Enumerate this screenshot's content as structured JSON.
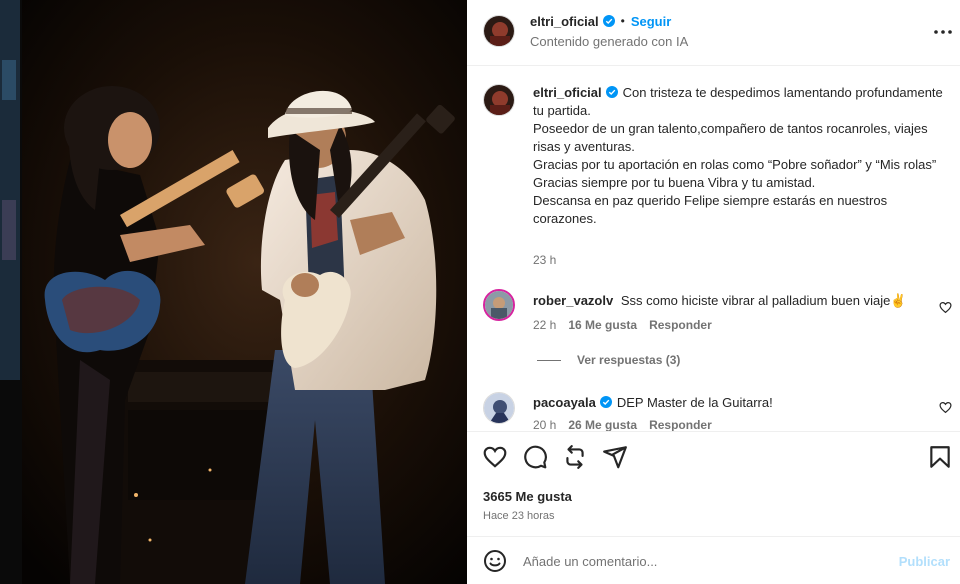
{
  "post": {
    "author": "eltri_oficial",
    "follow_label": "Seguir",
    "separator": "•",
    "subtitle": "Contenido generado con IA",
    "more_icon": "more-horizontal-icon"
  },
  "caption": {
    "username": "eltri_oficial",
    "lines": [
      "Con tristeza te despedimos lamentando profundamente tu partida.",
      "Poseedor de un gran talento,compañero de tantos rocanroles, viajes risas y aventuras.",
      "Gracias por tu aportación en rolas como “Pobre soñador” y “Mis rolas”",
      "Gracias siempre por tu buena Vibra y tu amistad.",
      "Descansa en paz querido Felipe siempre estarás en nuestros corazones."
    ],
    "time": "23 h"
  },
  "comments": [
    {
      "username": "rober_vazolv",
      "text": "Sss como hiciste vibrar al palladium buen viaje✌",
      "time": "22 h",
      "likes": "16 Me gusta",
      "reply_label": "Responder",
      "view_replies": "Ver respuestas (3)"
    },
    {
      "username": "pacoayala",
      "text": "DEP Master de la Guitarra!",
      "time": "20 h",
      "likes": "26 Me gusta",
      "reply_label": "Responder"
    }
  ],
  "actions": {
    "icons": [
      "heart-icon",
      "comment-icon",
      "repost-icon",
      "share-icon",
      "bookmark-icon"
    ],
    "likes_count": "3665 Me gusta",
    "time_ago": "Hace 23 horas"
  },
  "add_comment": {
    "placeholder": "Añade un comentario...",
    "post_label": "Publicar"
  },
  "colors": {
    "link_blue": "#0095f6",
    "verified_blue": "#0095f6",
    "muted_text": "#737373",
    "post_disabled": "#b2dffc"
  }
}
